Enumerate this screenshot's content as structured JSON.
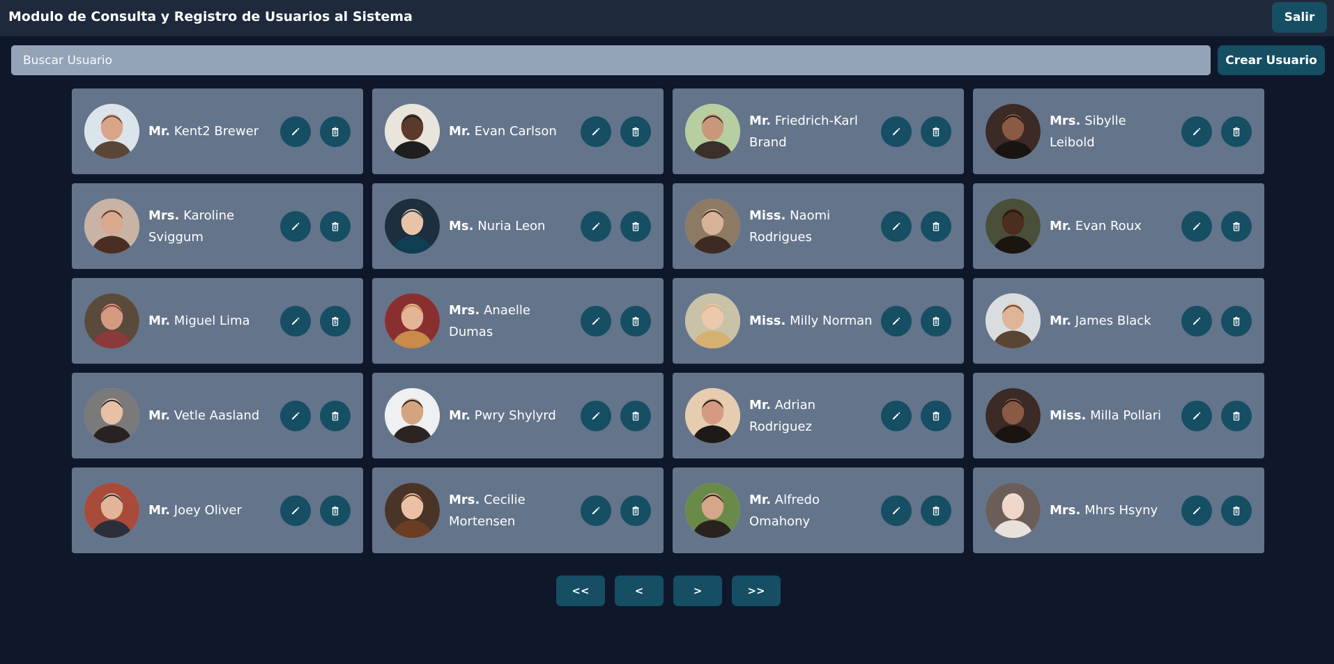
{
  "header": {
    "title": "Modulo de Consulta y Registro de Usuarios al Sistema",
    "logout_label": "Salir"
  },
  "search": {
    "placeholder": "Buscar Usuario",
    "value": ""
  },
  "toolbar": {
    "create_label": "Crear Usuario"
  },
  "colors": {
    "background": "#0f172a",
    "header": "#1e293b",
    "card": "#64748b",
    "accent": "#164e63",
    "search": "#94a3b8"
  },
  "users": [
    {
      "title": "Mr.",
      "name": "Kent2 Brewer"
    },
    {
      "title": "Mr.",
      "name": "Evan Carlson"
    },
    {
      "title": "Mr.",
      "name": "Friedrich-Karl Brand"
    },
    {
      "title": "Mrs.",
      "name": "Sibylle Leibold"
    },
    {
      "title": "Mrs.",
      "name": "Karoline Sviggum"
    },
    {
      "title": "Ms.",
      "name": "Nuria Leon"
    },
    {
      "title": "Miss.",
      "name": "Naomi Rodrigues"
    },
    {
      "title": "Mr.",
      "name": "Evan Roux"
    },
    {
      "title": "Mr.",
      "name": "Miguel Lima"
    },
    {
      "title": "Mrs.",
      "name": "Anaelle Dumas"
    },
    {
      "title": "Miss.",
      "name": "Milly Norman"
    },
    {
      "title": "Mr.",
      "name": "James Black"
    },
    {
      "title": "Mr.",
      "name": "Vetle Aasland"
    },
    {
      "title": "Mr.",
      "name": "Pwry Shylyrd"
    },
    {
      "title": "Mr.",
      "name": "Adrian Rodriguez"
    },
    {
      "title": "Miss.",
      "name": "Milla Pollari"
    },
    {
      "title": "Mr.",
      "name": "Joey Oliver"
    },
    {
      "title": "Mrs.",
      "name": "Cecilie Mortensen"
    },
    {
      "title": "Mr.",
      "name": "Alfredo Omahony"
    },
    {
      "title": "Mrs.",
      "name": "Mhrs Hsyny"
    }
  ],
  "pagination": {
    "first": "<<",
    "prev": "<",
    "next": ">",
    "last": ">>"
  }
}
